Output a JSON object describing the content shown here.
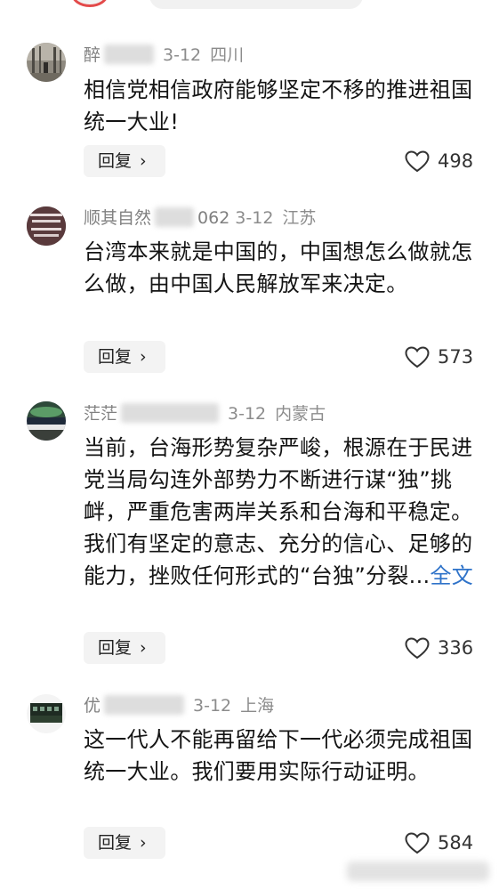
{
  "comments": [
    {
      "username": "醉",
      "date": "3-12",
      "location": "四川",
      "text": "相信党相信政府能够坚定不移的推进祖国统一大业!",
      "more_label": "",
      "reply_label": "回复",
      "likes": "498"
    },
    {
      "username": "顺其自然",
      "username_tail": "062",
      "date": "3-12",
      "location": "江苏",
      "text": "台湾本来就是中国的，中国想怎么做就怎么做，由中国人民解放军来决定。",
      "more_label": "",
      "reply_label": "回复",
      "likes": "573"
    },
    {
      "username": "茫茫",
      "date": "3-12",
      "location": "内蒙古",
      "text": "当前，台海形势复杂严峻，根源在于民进党当局勾连外部势力不断进行谋“独”挑衅，严重危害两岸关系和台海和平稳定。我们有坚定的意志、充分的信心、足够的能力，挫败任何形式的“台独”分裂...",
      "more_label": "全文",
      "reply_label": "回复",
      "likes": "336"
    },
    {
      "username": "优",
      "date": "3-12",
      "location": "上海",
      "text": "这一代人不能再留给下一代必须完成祖国统一大业。我们要用实际行动证明。",
      "more_label": "",
      "reply_label": "回复",
      "likes": "584"
    }
  ],
  "icons": {
    "like": "heart-outline-icon",
    "reply_chevron": "chevron-right-icon"
  },
  "colors": {
    "link": "#2f73c9",
    "meta": "#8c8c8c",
    "reply_bg": "#f3f3f3"
  }
}
